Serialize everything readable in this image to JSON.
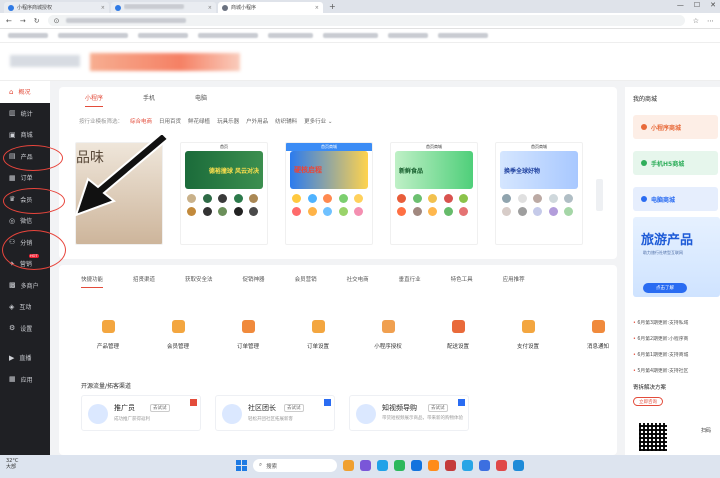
{
  "browser": {
    "tabs": [
      {
        "title": "小程序商城授权",
        "close": "×"
      },
      {
        "title": "",
        "close": "×"
      },
      {
        "title": "商城小程序",
        "close": "×"
      }
    ],
    "new_tab": "+",
    "window_controls": [
      "—",
      "☐",
      "✕"
    ]
  },
  "sidebar": {
    "items": [
      {
        "label": "概况",
        "icon": "home-icon",
        "active": true
      },
      {
        "label": "统计",
        "icon": "stats-icon"
      },
      {
        "label": "商城",
        "icon": "store-icon"
      },
      {
        "label": "产品",
        "icon": "product-icon"
      },
      {
        "label": "订单",
        "icon": "order-icon"
      },
      {
        "label": "会员",
        "icon": "member-icon"
      },
      {
        "label": "微信",
        "icon": "wechat-icon"
      },
      {
        "label": "分销",
        "icon": "distribution-icon"
      },
      {
        "label": "营销",
        "icon": "marketing-icon",
        "badge": "HOT"
      },
      {
        "label": "多商户",
        "icon": "merchant-icon"
      },
      {
        "label": "互动",
        "icon": "interact-icon"
      },
      {
        "label": "设置",
        "icon": "settings-icon"
      },
      {
        "label": "直播",
        "icon": "live-icon"
      },
      {
        "label": "应用",
        "icon": "apps-icon"
      }
    ]
  },
  "templates": {
    "tabs": [
      "小程序",
      "手机",
      "电脑"
    ],
    "filter_label": "按行业模板筛选：",
    "filters": [
      "综合电商",
      "日用百货",
      "鲜花绿植",
      "玩具乐器",
      "户外用品",
      "纺织辅料",
      "更多行业 ⌄"
    ],
    "thumbs": [
      {
        "bar": "",
        "big": "品味"
      },
      {
        "bar": "首页",
        "hero": "德裕撞球 风云对决"
      },
      {
        "bar": "首页商城",
        "hero": "硬核启程"
      },
      {
        "bar": "首页商城",
        "hero": "新鲜食品"
      },
      {
        "bar": "首页商城",
        "hero": "换季全球好物"
      }
    ]
  },
  "features": {
    "tabs": [
      "快捷功能",
      "招贤渠道",
      "获取安全法",
      "促销神器",
      "会员营销",
      "社交电商",
      "垂直行业",
      "特色工具",
      "应用推荐"
    ],
    "items": [
      "产品管理",
      "会员管理",
      "订单管理",
      "订单设置",
      "小程序授权",
      "配送设置",
      "支付设置",
      "消息通知"
    ],
    "section_title": "开源流量/拓客渠道",
    "promos": [
      {
        "title": "推广员",
        "tag": "去试试",
        "desc": "成功推广获得返利"
      },
      {
        "title": "社区团长",
        "tag": "去试试",
        "desc": "轻松开团社区拓展新客"
      },
      {
        "title": "知视频导购",
        "tag": "去试试",
        "desc": "带货短视频展示商品，带来新的购物体验"
      }
    ]
  },
  "right_panel": {
    "title": "我的商城",
    "shops": [
      {
        "label": "小程序商城",
        "color": "#e86a3a",
        "bg": "#fdeee6"
      },
      {
        "label": "手机H5商城",
        "color": "#2fae5b",
        "bg": "#e6f6ec"
      },
      {
        "label": "电脑商城",
        "color": "#2a6cf2",
        "bg": "#e6eefd"
      }
    ],
    "banner": {
      "title": "旅游产品",
      "subtitle": "助力旅行社转型互联网",
      "button": "点击了解"
    },
    "news": [
      {
        "date": "6月第3期更新:",
        "text": "支持私域"
      },
      {
        "date": "6月第2期更新:",
        "text": "小程序商"
      },
      {
        "date": "6月第1期更新:",
        "text": "支持商城"
      },
      {
        "date": "5月第4期更新:",
        "text": "支持社区"
      }
    ],
    "solution_title": "寄拆解决方案",
    "solution_button": "立即咨询",
    "qr_caption": "扫码"
  },
  "taskbar": {
    "temp": "32°C",
    "weather": "大部",
    "search": "搜索",
    "app_colors": [
      "#f0a030",
      "#7a56d8",
      "#1fa2e8",
      "#2db85c",
      "#1273de",
      "#ff8c1a",
      "#c43b3b",
      "#28a5e6",
      "#3c6fe0",
      "#e04848",
      "#1e8bd8"
    ]
  }
}
